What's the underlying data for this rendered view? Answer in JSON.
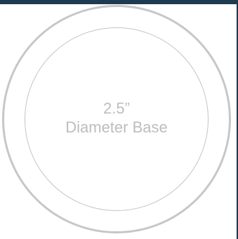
{
  "base": {
    "size_label": "2.5”",
    "description_label": "Diameter Base"
  },
  "colors": {
    "accent_bar": "#1f3b4f",
    "ring": "#c7c7c7",
    "label_text": "#bdbdbd",
    "background": "#ffffff"
  }
}
